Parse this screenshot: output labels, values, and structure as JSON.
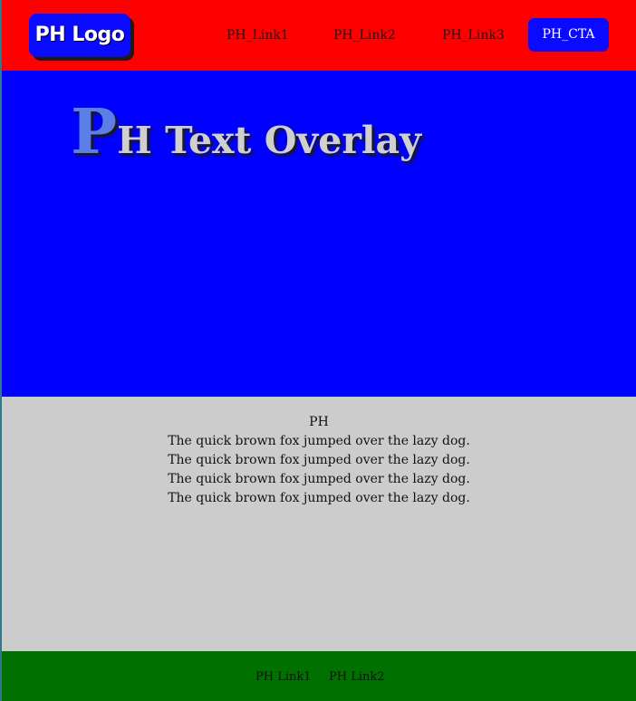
{
  "header": {
    "logo_text": "PH Logo",
    "nav_links": [
      "PH_Link1",
      "PH_Link2",
      "PH_Link3"
    ],
    "cta_label": "PH_CTA"
  },
  "hero": {
    "title_initial": "P",
    "title_rest": "H Text Overlay"
  },
  "content": {
    "heading": "PH",
    "lines": [
      "The quick brown fox jumped over the lazy dog.",
      "The quick brown fox jumped over the lazy dog.",
      "The quick brown fox jumped over the lazy dog.",
      "The quick brown fox jumped over the lazy dog."
    ]
  },
  "footer": {
    "links": [
      "PH Link1",
      "PH Link2"
    ]
  },
  "colors": {
    "header_bg": "#ff0000",
    "hero_bg": "#0000ff",
    "content_bg": "#cccccc",
    "footer_bg": "#007000",
    "button_bg": "#0a0aff"
  }
}
